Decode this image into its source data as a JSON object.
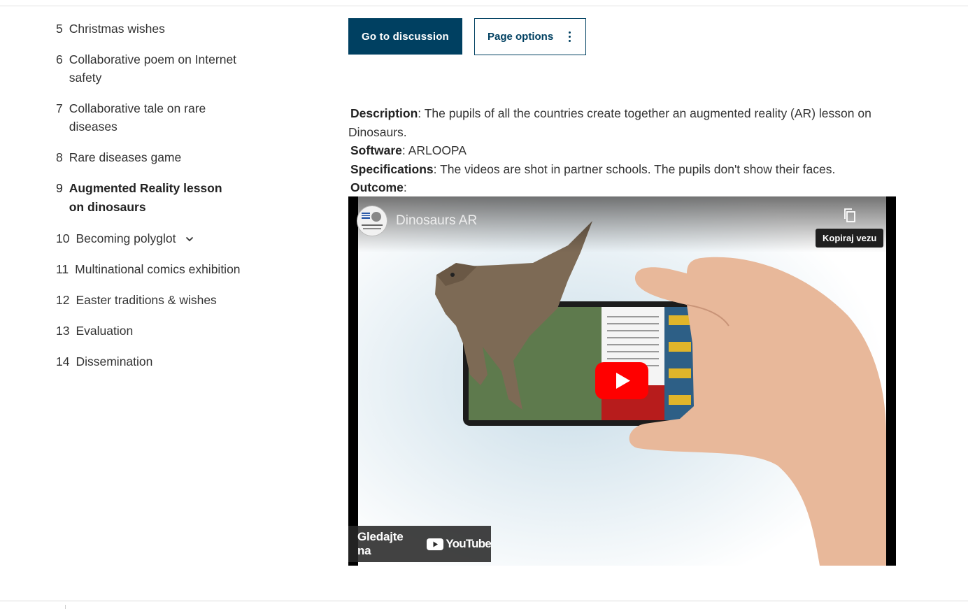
{
  "nav": {
    "items": [
      {
        "num": "5",
        "label": "Christmas wishes"
      },
      {
        "num": "6",
        "label": "Collaborative poem on Internet safety"
      },
      {
        "num": "7",
        "label": "Collaborative tale on rare diseases"
      },
      {
        "num": "8",
        "label": "Rare diseases game"
      },
      {
        "num": "9",
        "label": "Augmented Reality lesson on dinosaurs",
        "active": true
      },
      {
        "num": "10",
        "label": "Becoming polyglot",
        "expandable": true
      },
      {
        "num": "11",
        "label": "Multinational comics exhibition"
      },
      {
        "num": "12",
        "label": "Easter traditions & wishes"
      },
      {
        "num": "13",
        "label": "Evaluation"
      },
      {
        "num": "14",
        "label": "Dissemination"
      }
    ]
  },
  "actions": {
    "discussion_label": "Go to discussion",
    "options_label": "Page options"
  },
  "content": {
    "description_label": "Description",
    "description_text": ": The pupils of all the countries create together an augmented reality (AR) lesson on Dinosaurs.",
    "software_label": "Software",
    "software_text": ": ARLOOPA",
    "specifications_label": "Specifications",
    "specifications_text": ": The videos are shot in partner schools. The pupils don't show their faces.",
    "outcome_label": "Outcome",
    "outcome_text": ":"
  },
  "video": {
    "title": "Dinosaurs AR",
    "copy_link_tooltip": "Kopiraj vezu",
    "watch_on_label": "Gledajte na",
    "youtube_wordmark": "YouTube",
    "play_color": "#ff0000",
    "icons": [
      "copy-icon",
      "play-icon",
      "youtube-logo-icon",
      "channel-avatar"
    ]
  },
  "colors": {
    "primary": "#004061",
    "text": "#333333"
  }
}
